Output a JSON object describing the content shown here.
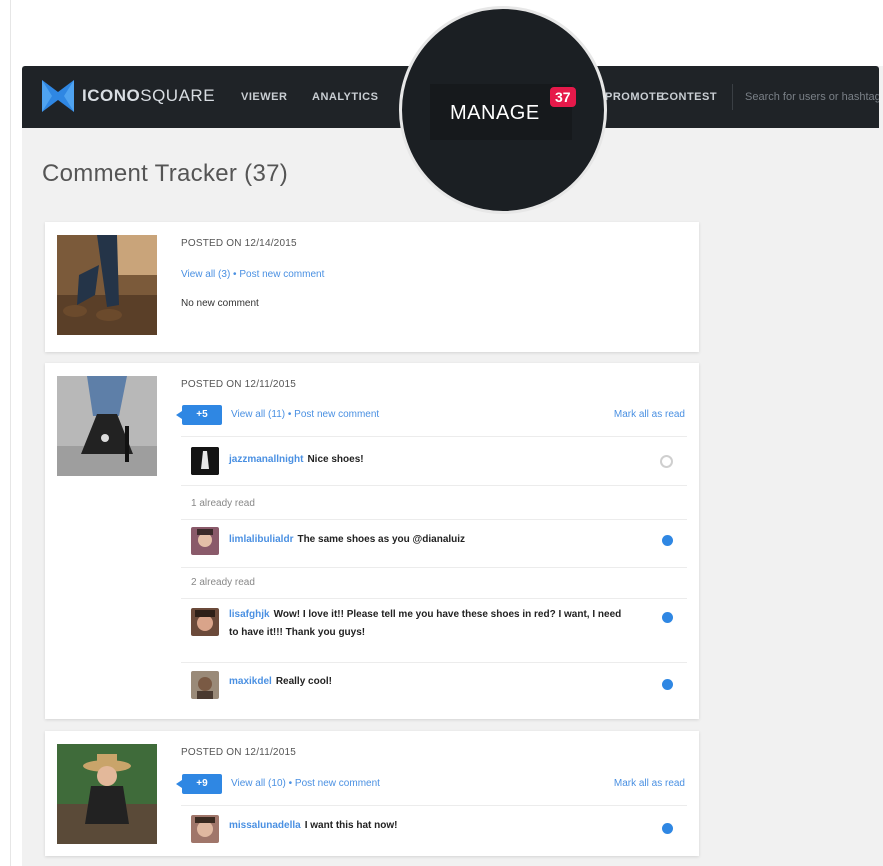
{
  "nav": {
    "brand_bold": "ICONO",
    "brand_thin": "SQUARE",
    "items": [
      "VIEWER",
      "ANALYTICS",
      "PROMOTE",
      "CONTEST"
    ],
    "search_placeholder": "Search for users or hashtags",
    "manage_label": "MANAGE",
    "manage_badge": "37"
  },
  "page_title": "Comment Tracker (37)",
  "posts": [
    {
      "posted": "POSTED ON 12/14/2015",
      "view_all": "View all (3) • Post new comment",
      "status": "No new comment"
    },
    {
      "posted": "POSTED ON 12/11/2015",
      "count_badge": "+5",
      "view_all": "View all (11) • Post new comment",
      "mark_all": "Mark all as read",
      "comments": [
        {
          "user": "jazzmanallnight",
          "text": "Nice shoes!",
          "read": true
        },
        {
          "user": "limlalibulialdr",
          "text": "The same shoes as you @dianaluiz",
          "read": false
        },
        {
          "user": "lisafghjk",
          "text": "Wow! I love it!! Please tell me you have these shoes in red? I want, I need to have it!!! Thank you guys!",
          "read": false
        },
        {
          "user": "maxikdel",
          "text": "Really cool!",
          "read": false
        }
      ],
      "already_read": [
        "1 already read",
        "2 already read"
      ]
    },
    {
      "posted": "POSTED ON 12/11/2015",
      "count_badge": "+9",
      "view_all": "View all (10) • Post new comment",
      "mark_all": "Mark all as read",
      "comments": [
        {
          "user": "missalunadella",
          "text": "I want this hat now!",
          "read": false
        }
      ]
    }
  ],
  "colors": {
    "nav_bg": "#1f2327",
    "accent_blue": "#2f87e3",
    "badge_red": "#e6194a",
    "link_blue": "#4a90e2"
  }
}
